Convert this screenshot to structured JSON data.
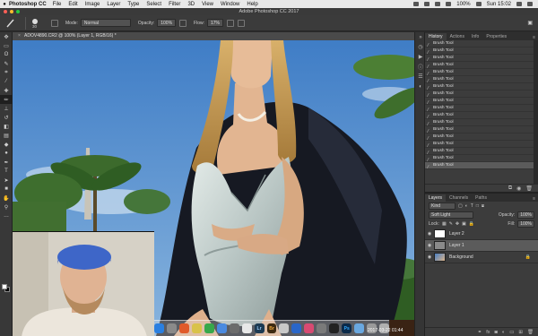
{
  "menubar": {
    "app": "Photoshop CC",
    "items": [
      "File",
      "Edit",
      "Image",
      "Layer",
      "Type",
      "Select",
      "Filter",
      "3D",
      "View",
      "Window",
      "Help"
    ],
    "battery": "100%",
    "clock": "Sun 15:02"
  },
  "window": {
    "title": "Adobe Photoshop CC 2017"
  },
  "options": {
    "brush_size": "30",
    "mode_label": "Mode:",
    "mode_value": "Normal",
    "opacity_label": "Opacity:",
    "opacity_value": "100%",
    "flow_label": "Flow:",
    "flow_value": "17%"
  },
  "document": {
    "tab_title": "ADOV4890.CR2 @ 100% (Layer 1, RGB/16) *",
    "close_glyph": "×"
  },
  "history": {
    "tabs": [
      "History",
      "Actions",
      "Info",
      "Properties"
    ],
    "rows": [
      "Brush Tool",
      "Brush Tool",
      "Brush Tool",
      "Brush Tool",
      "Brush Tool",
      "Brush Tool",
      "Brush Tool",
      "Brush Tool",
      "Brush Tool",
      "Brush Tool",
      "Brush Tool",
      "Brush Tool",
      "Brush Tool",
      "Brush Tool",
      "Brush Tool",
      "Brush Tool",
      "Brush Tool",
      "Brush Tool"
    ]
  },
  "layers": {
    "tabs": [
      "Layers",
      "Channels",
      "Paths"
    ],
    "kind": "Kind",
    "blend_mode": "Soft Light",
    "opacity_label": "Opacity:",
    "opacity_value": "100%",
    "lock_label": "Lock:",
    "fill_label": "Fill:",
    "fill_value": "100%",
    "items": [
      {
        "name": "Layer 2"
      },
      {
        "name": "Layer 1"
      },
      {
        "name": "Background"
      }
    ]
  },
  "icons": {
    "tools": [
      "move-icon",
      "marquee-icon",
      "lasso-icon",
      "quick-select-icon",
      "crop-icon",
      "eyedropper-icon",
      "healing-icon",
      "brush-icon",
      "stamp-icon",
      "history-brush-icon",
      "eraser-icon",
      "gradient-icon",
      "blur-icon",
      "dodge-icon",
      "pen-icon",
      "type-icon",
      "path-select-icon",
      "shape-icon",
      "hand-icon",
      "zoom-icon"
    ]
  },
  "dock": {
    "apps": [
      {
        "label": "",
        "color": "#2a7fe0"
      },
      {
        "label": "",
        "color": "#8a8a8a"
      },
      {
        "label": "",
        "color": "#e05a2a"
      },
      {
        "label": "",
        "color": "#d9c24a"
      },
      {
        "label": "",
        "color": "#37a84b"
      },
      {
        "label": "",
        "color": "#4a8ae0"
      },
      {
        "label": "",
        "color": "#6c6c6c"
      },
      {
        "label": "",
        "color": "#e8e8e8"
      },
      {
        "label": "Lr",
        "color": "#1c3a52"
      },
      {
        "label": "Br",
        "color": "#3d2a12"
      },
      {
        "label": "",
        "color": "#c8c8c8"
      },
      {
        "label": "",
        "color": "#2a66c8"
      },
      {
        "label": "",
        "color": "#d84a72"
      },
      {
        "label": "",
        "color": "#7a7a7a"
      },
      {
        "label": "",
        "color": "#222222"
      },
      {
        "label": "Ps",
        "color": "#0b2a4a"
      },
      {
        "label": "",
        "color": "#6aa8e0"
      },
      {
        "label": "",
        "color": "#9a9a9a"
      },
      {
        "label": "",
        "color": "#b0b0b0"
      }
    ],
    "clock": "2017-03-22 01:44"
  }
}
